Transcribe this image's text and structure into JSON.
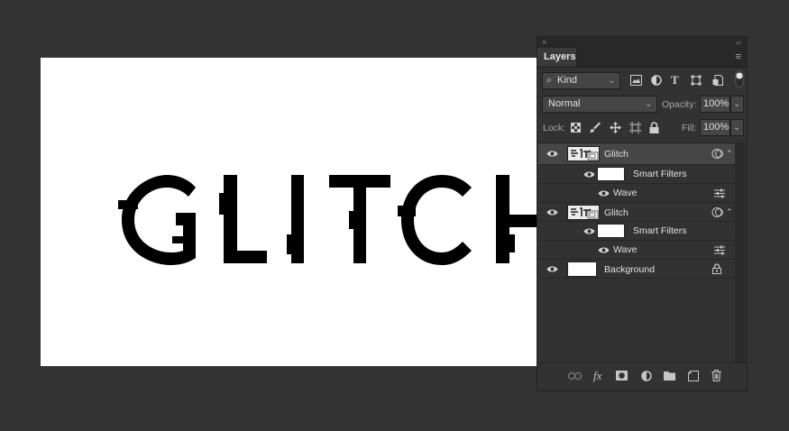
{
  "canvas": {
    "artwork_text": "GLITCH",
    "text_color": "#000000",
    "background_color": "#ffffff"
  },
  "panel": {
    "close_glyph": "×",
    "collapse_glyph": "‹‹",
    "tab_label": "Layers",
    "menu_glyph": "≡",
    "filter": {
      "value": "Kind",
      "search_glyph": "⌕",
      "chevron": "⌄"
    },
    "filter_icons": {
      "type_glyph": "T"
    },
    "blend": {
      "value": "Normal",
      "chevron": "⌄"
    },
    "opacity": {
      "label": "Opacity:",
      "value": "100%",
      "chevron": "⌄"
    },
    "lock": {
      "label": "Lock:"
    },
    "fill": {
      "label": "Fill:",
      "value": "100%",
      "chevron": "⌄"
    },
    "layers": [
      {
        "name": "Glitch",
        "kind": "smart-object",
        "selected": true,
        "expanded": true
      },
      {
        "name": "Smart Filters",
        "kind": "smart-filters"
      },
      {
        "name": "Wave",
        "kind": "filter"
      },
      {
        "name": "Glitch",
        "kind": "smart-object",
        "selected": false,
        "expanded": true
      },
      {
        "name": "Smart Filters",
        "kind": "smart-filters"
      },
      {
        "name": "Wave",
        "kind": "filter"
      },
      {
        "name": "Background",
        "kind": "background",
        "locked": true
      }
    ],
    "bottom_icons": {
      "fx_label": "fx"
    }
  }
}
